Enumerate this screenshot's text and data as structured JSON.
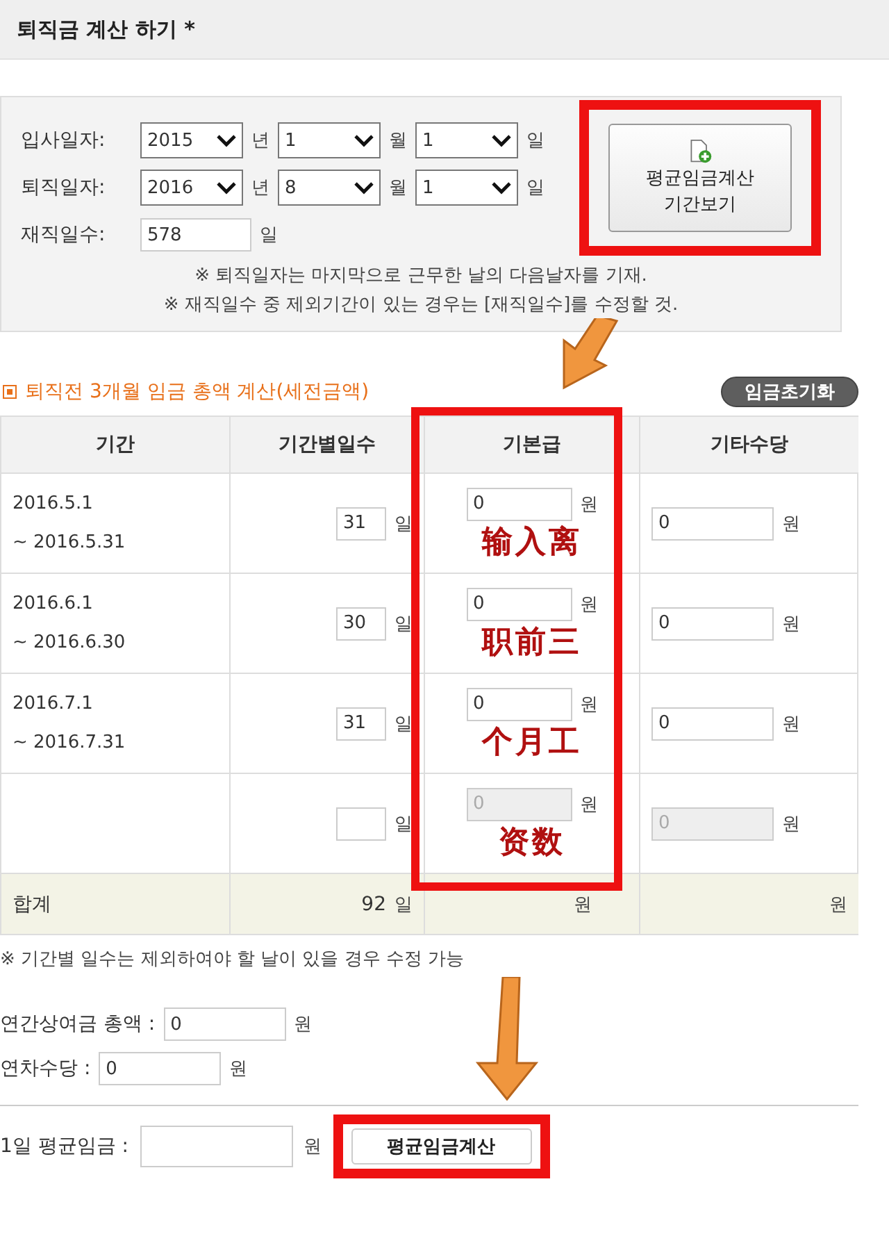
{
  "title": "퇴직금 계산 하기 *",
  "dates": [
    {
      "label": "입사일자:",
      "year": "2015",
      "year_unit": "년",
      "month": "1",
      "month_unit": "월",
      "day": "1",
      "day_unit": "일"
    },
    {
      "label": "퇴직일자:",
      "year": "2016",
      "year_unit": "년",
      "month": "8",
      "month_unit": "월",
      "day": "1",
      "day_unit": "일"
    }
  ],
  "tenure": {
    "label": "재직일수:",
    "value": "578",
    "unit": "일"
  },
  "period_button": {
    "lines": [
      "평균임금계산",
      "기간보기"
    ],
    "highlighted": true
  },
  "notes": [
    "※ 퇴직일자는 마지막으로 근무한 날의 다음날자를 기재.",
    "※ 재직일수 중 제외기간이 있는 경우는 [재직일수]를 수정할 것."
  ],
  "section": {
    "title": "퇴직전 3개월 임금 총액 계산(세전금액)",
    "reset_button": "임금초기화"
  },
  "table": {
    "columns": [
      "기간",
      "기간별일수",
      "기본급",
      "기타수당"
    ],
    "base_highlighted": true,
    "rows": [
      {
        "period": [
          "2016.5.1",
          "~ 2016.5.31"
        ],
        "days": "31",
        "day_unit": "일",
        "base": "0",
        "base_unit": "원",
        "other": "0",
        "other_unit": "원",
        "disabled": false
      },
      {
        "period": [
          "2016.6.1",
          "~ 2016.6.30"
        ],
        "days": "30",
        "day_unit": "일",
        "base": "0",
        "base_unit": "원",
        "other": "0",
        "other_unit": "원",
        "disabled": false
      },
      {
        "period": [
          "2016.7.1",
          "~ 2016.7.31"
        ],
        "days": "31",
        "day_unit": "일",
        "base": "0",
        "base_unit": "원",
        "other": "0",
        "other_unit": "원",
        "disabled": false
      },
      {
        "period": [],
        "days": "",
        "day_unit": "일",
        "base": "0",
        "base_unit": "원",
        "other": "0",
        "other_unit": "원",
        "disabled": true
      }
    ],
    "total": {
      "label": "합계",
      "days": "92",
      "day_unit": "일",
      "base_unit": "원",
      "other_unit": "원"
    }
  },
  "table_note": "※ 기간별 일수는 제외하여야 할 날이 있을 경우 수정 가능",
  "extras": [
    {
      "label": "연간상여금 총액 :",
      "value": "0",
      "unit": "원"
    },
    {
      "label": "연차수당 :",
      "value": "0",
      "unit": "원"
    }
  ],
  "average": {
    "label": "1일 평균임금 :",
    "unit": "원",
    "button": "평균임금계산",
    "highlighted": true
  },
  "annotation": {
    "lines": [
      "输入离",
      "职前三",
      "个月工",
      "资数"
    ]
  }
}
